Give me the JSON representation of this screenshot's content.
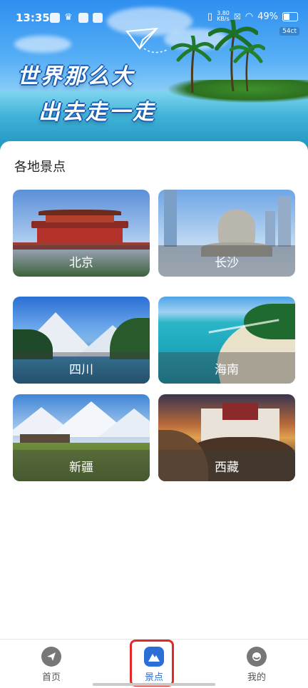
{
  "status_bar": {
    "time": "13:35",
    "net_speed_value": "3.80",
    "net_speed_unit": "KB/s",
    "battery": "49%",
    "badge": "54ct"
  },
  "banner": {
    "slogan_line1": "世界那么大",
    "slogan_line2": "出去走一走"
  },
  "section": {
    "title": "各地景点"
  },
  "attractions": [
    {
      "name": "北京"
    },
    {
      "name": "长沙"
    },
    {
      "name": "四川"
    },
    {
      "name": "海南"
    },
    {
      "name": "新疆"
    },
    {
      "name": "西藏"
    }
  ],
  "bottom_nav": {
    "home": "首页",
    "spots": "景点",
    "mine": "我的"
  },
  "colors": {
    "active_tab": "#2b6fd6",
    "highlight": "#e32a2a"
  }
}
